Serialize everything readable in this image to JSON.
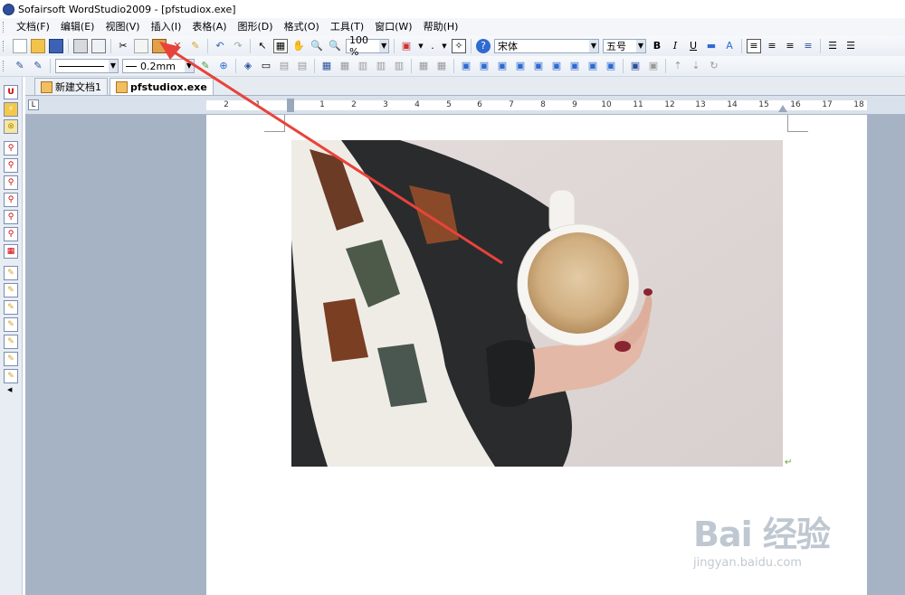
{
  "window": {
    "title": "Sofairsoft WordStudio2009 - [pfstudiox.exe]"
  },
  "menu": [
    "文档(F)",
    "编辑(E)",
    "视图(V)",
    "插入(I)",
    "表格(A)",
    "图形(D)",
    "格式(O)",
    "工具(T)",
    "窗口(W)",
    "帮助(H)"
  ],
  "toolbar1": {
    "zoom": "100 %",
    "font_name": "宋体",
    "font_size": "五号",
    "bold": "B",
    "italic": "I",
    "underline": "U"
  },
  "toolbar2": {
    "line_width": "0.2mm"
  },
  "tabs": [
    {
      "label": "新建文档1",
      "active": false
    },
    {
      "label": "pfstudiox.exe",
      "active": true
    }
  ],
  "ruler": {
    "labels": [
      "2",
      "1",
      "1",
      "2",
      "3",
      "4",
      "5",
      "6",
      "7",
      "8",
      "9",
      "10",
      "11",
      "12",
      "13",
      "14",
      "15",
      "16",
      "17",
      "18"
    ]
  },
  "document": {
    "paragraph_mark": "↵"
  },
  "watermark": {
    "main": "Bai 经验",
    "sub": "jingyan.baidu.com"
  },
  "colors": {
    "arrow": "#e8433a",
    "workspace": "#a5b3c5"
  }
}
